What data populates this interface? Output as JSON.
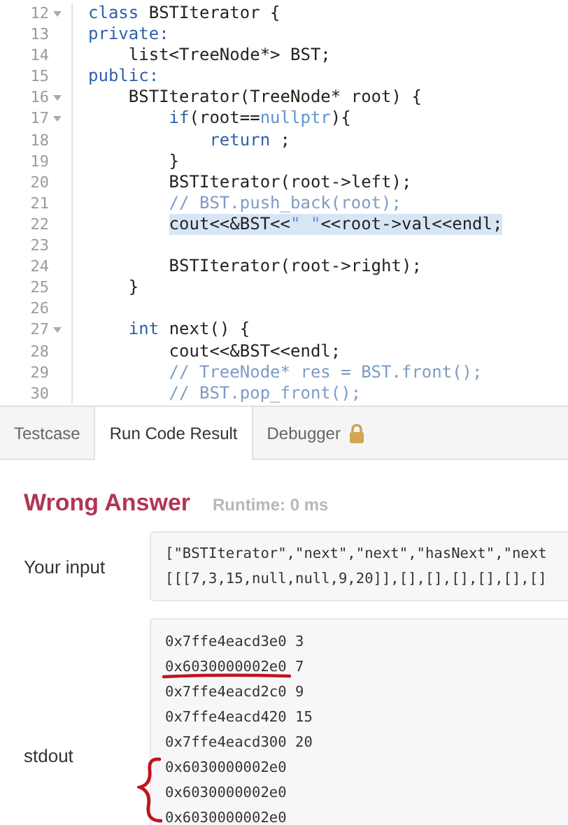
{
  "editor": {
    "lines": [
      {
        "number": "12",
        "fold": true,
        "selected": false,
        "tokens": [
          {
            "kind": "keyword",
            "text": "class"
          },
          {
            "kind": "plain",
            "text": " BSTIterator {"
          }
        ]
      },
      {
        "number": "13",
        "fold": false,
        "selected": false,
        "tokens": [
          {
            "kind": "keyword",
            "text": "private:"
          }
        ]
      },
      {
        "number": "14",
        "fold": false,
        "selected": false,
        "tokens": [
          {
            "kind": "plain",
            "text": "    list<TreeNode*> BST;"
          }
        ]
      },
      {
        "number": "15",
        "fold": false,
        "selected": false,
        "tokens": [
          {
            "kind": "keyword",
            "text": "public:"
          }
        ]
      },
      {
        "number": "16",
        "fold": true,
        "selected": false,
        "tokens": [
          {
            "kind": "plain",
            "text": "    BSTIterator(TreeNode* root) {"
          }
        ]
      },
      {
        "number": "17",
        "fold": true,
        "selected": false,
        "tokens": [
          {
            "kind": "keyword",
            "text": "        if"
          },
          {
            "kind": "plain",
            "text": "(root=="
          },
          {
            "kind": "constant",
            "text": "nullptr"
          },
          {
            "kind": "plain",
            "text": "){"
          }
        ]
      },
      {
        "number": "18",
        "fold": false,
        "selected": false,
        "tokens": [
          {
            "kind": "keyword",
            "text": "            return"
          },
          {
            "kind": "plain",
            "text": " ;"
          }
        ]
      },
      {
        "number": "19",
        "fold": false,
        "selected": false,
        "tokens": [
          {
            "kind": "plain",
            "text": "        }"
          }
        ]
      },
      {
        "number": "20",
        "fold": false,
        "selected": false,
        "tokens": [
          {
            "kind": "plain",
            "text": "        BSTIterator(root->left);"
          }
        ]
      },
      {
        "number": "21",
        "fold": false,
        "selected": false,
        "tokens": [
          {
            "kind": "comment",
            "text": "        // BST.push_back(root);"
          }
        ]
      },
      {
        "number": "22",
        "fold": false,
        "selected": true,
        "tokens": [
          {
            "kind": "plain",
            "text": "        cout<<&BST<<"
          },
          {
            "kind": "string",
            "text": "\" \""
          },
          {
            "kind": "plain",
            "text": "<<root->val<<endl;"
          }
        ]
      },
      {
        "number": "23",
        "fold": false,
        "selected": false
      },
      {
        "number": "24",
        "fold": false,
        "selected": false,
        "tokens": [
          {
            "kind": "plain",
            "text": "        BSTIterator(root->right);"
          }
        ]
      },
      {
        "number": "25",
        "fold": false,
        "selected": false,
        "tokens": [
          {
            "kind": "plain",
            "text": "    }"
          }
        ]
      },
      {
        "number": "26",
        "fold": false,
        "selected": false
      },
      {
        "number": "27",
        "fold": true,
        "selected": false,
        "tokens": [
          {
            "kind": "keyword",
            "text": "    int"
          },
          {
            "kind": "plain",
            "text": " next() {"
          }
        ]
      },
      {
        "number": "28",
        "fold": false,
        "selected": false,
        "tokens": [
          {
            "kind": "plain",
            "text": "        cout<<&BST<<endl;"
          }
        ]
      },
      {
        "number": "29",
        "fold": false,
        "selected": false,
        "tokens": [
          {
            "kind": "comment",
            "text": "        // TreeNode* res = BST.front();"
          }
        ]
      },
      {
        "number": "30",
        "fold": false,
        "selected": false,
        "tokens": [
          {
            "kind": "comment",
            "text": "        // BST.pop_front();"
          }
        ]
      }
    ]
  },
  "tabs": [
    {
      "label": "Testcase",
      "selected": false,
      "locked": false
    },
    {
      "label": "Run Code Result",
      "selected": true,
      "locked": false
    },
    {
      "label": "Debugger",
      "selected": false,
      "locked": true
    }
  ],
  "result": {
    "status": "Wrong Answer",
    "runtime": "Runtime: 0 ms",
    "input": {
      "label": "Your input",
      "lines": [
        "[\"BSTIterator\",\"next\",\"next\",\"hasNext\",\"next",
        "[[[7,3,15,null,null,9,20]],[],[],[],[],[],[]"
      ]
    },
    "stdout": {
      "label": "stdout",
      "lines": [
        {
          "text": "0x7ffe4eacd3e0 3",
          "underlined": false
        },
        {
          "text": "0x6030000002e0 7",
          "underlined": true
        },
        {
          "text": "0x7ffe4eacd2c0 9",
          "underlined": false
        },
        {
          "text": "0x7ffe4eacd420 15",
          "underlined": false
        },
        {
          "text": "0x7ffe4eacd300 20",
          "underlined": false
        },
        {
          "text": "0x6030000002e0",
          "underlined": false
        },
        {
          "text": "0x6030000002e0",
          "underlined": false
        },
        {
          "text": "0x6030000002e0",
          "underlined": false
        }
      ]
    }
  }
}
